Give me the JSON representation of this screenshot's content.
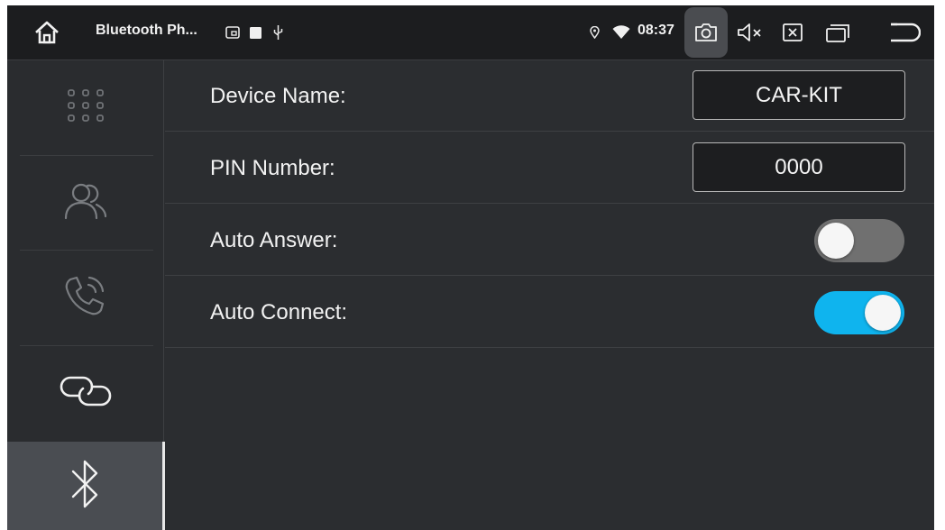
{
  "status_bar": {
    "app_title": "Bluetooth Ph...",
    "time": "08:37",
    "notification_icons": [
      "cast-icon",
      "stop-square-icon",
      "usb-icon"
    ],
    "system_icons": [
      "location-pin-icon",
      "wifi-icon"
    ],
    "controls": [
      "screenshot-camera-icon",
      "volume-mute-icon",
      "close-window-icon",
      "recent-apps-icon",
      "back-icon"
    ]
  },
  "sidebar": {
    "items": [
      {
        "name": "dialpad",
        "icon": "dialpad-icon",
        "active": false
      },
      {
        "name": "contacts",
        "icon": "contacts-icon",
        "active": false
      },
      {
        "name": "call-log",
        "icon": "phone-call-icon",
        "active": false
      },
      {
        "name": "pairing",
        "icon": "link-icon",
        "active": false
      },
      {
        "name": "bluetooth-settings",
        "icon": "bluetooth-icon",
        "active": true
      }
    ]
  },
  "settings": {
    "device_name": {
      "label": "Device Name:",
      "value": "CAR-KIT"
    },
    "pin_number": {
      "label": "PIN Number:",
      "value": "0000"
    },
    "auto_answer": {
      "label": "Auto Answer:",
      "enabled": false
    },
    "auto_connect": {
      "label": "Auto Connect:",
      "enabled": true
    }
  },
  "colors": {
    "accent": "#0fb4ee",
    "background": "#2b2d30",
    "status_bar": "#1c1d1f",
    "toggle_off": "#707070"
  }
}
